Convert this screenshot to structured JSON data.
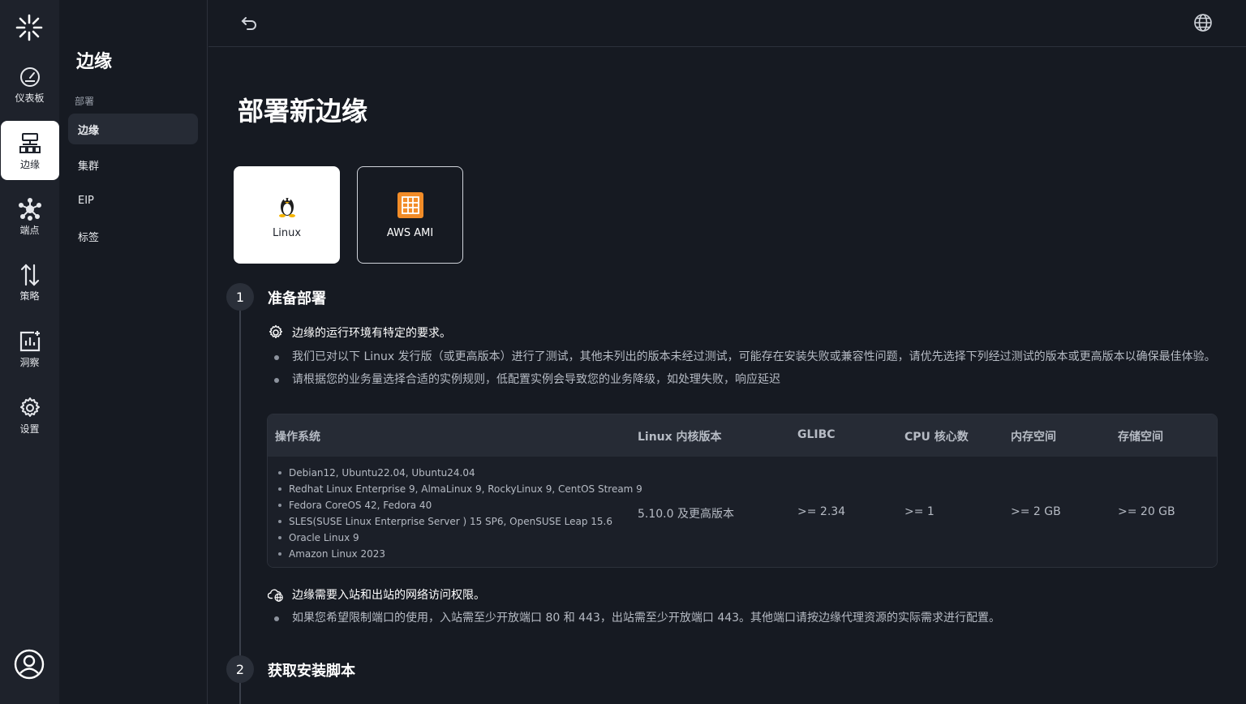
{
  "rail": {
    "items": [
      {
        "label": "仪表板",
        "icon": "dashboard-icon"
      },
      {
        "label": "边缘",
        "icon": "edge-topology-icon"
      },
      {
        "label": "端点",
        "icon": "endpoints-hub-icon"
      },
      {
        "label": "策略",
        "icon": "policy-arrows-icon"
      },
      {
        "label": "洞察",
        "icon": "insights-chart-icon"
      },
      {
        "label": "设置",
        "icon": "gear-icon"
      }
    ],
    "active_index": 1
  },
  "sidebar": {
    "title": "边缘",
    "group_label": "部署",
    "items": [
      {
        "label": "边缘"
      },
      {
        "label": "集群"
      },
      {
        "label": "EIP"
      },
      {
        "label": "标签"
      }
    ]
  },
  "page": {
    "title": "部署新边缘"
  },
  "os_options": [
    {
      "label": "Linux",
      "icon": "linux-penguin-icon",
      "selected": true
    },
    {
      "label": "AWS AMI",
      "icon": "aws-ami-icon",
      "selected": false
    }
  ],
  "steps": [
    {
      "number": "1",
      "title": "准备部署"
    },
    {
      "number": "2",
      "title": "获取安装脚本"
    }
  ],
  "requirements": {
    "env_heading": "边缘的运行环境有特定的要求。",
    "env_bullets": [
      "我们已对以下 Linux 发行版（或更高版本）进行了测试，其他未列出的版本未经过测试，可能存在安装失败或兼容性问题，请优先选择下列经过测试的版本或更高版本以确保最佳体验。",
      "请根据您的业务量选择合适的实例规则，低配置实例会导致您的业务降级，如处理失败，响应延迟"
    ],
    "table": {
      "headers": [
        "操作系统",
        "Linux 内核版本",
        "GLIBC",
        "CPU 核心数",
        "内存空间",
        "存储空间"
      ],
      "os_list": [
        "Debian12, Ubuntu22.04, Ubuntu24.04",
        "Redhat Linux Enterprise 9, AlmaLinux 9, RockyLinux 9, CentOS Stream 9",
        "Fedora CoreOS 42, Fedora 40",
        "SLES(SUSE Linux Enterprise Server ) 15 SP6, OpenSUSE Leap 15.6",
        "Oracle Linux 9",
        "Amazon Linux 2023"
      ],
      "kernel": "5.10.0 及更高版本",
      "glibc": ">= 2.34",
      "cpu": ">= 1",
      "memory": ">= 2 GB",
      "storage": ">= 20 GB"
    },
    "net_heading": "边缘需要入站和出站的网络访问权限。",
    "net_bullets": [
      "如果您希望限制端口的使用，入站需至少开放端口 80 和 443，出站需至少开放端口 443。其他端口请按边缘代理资源的实际需求进行配置。"
    ]
  },
  "colors": {
    "background": "#161a22",
    "rail": "#1e222b",
    "accent_orange": "#f28c28"
  }
}
